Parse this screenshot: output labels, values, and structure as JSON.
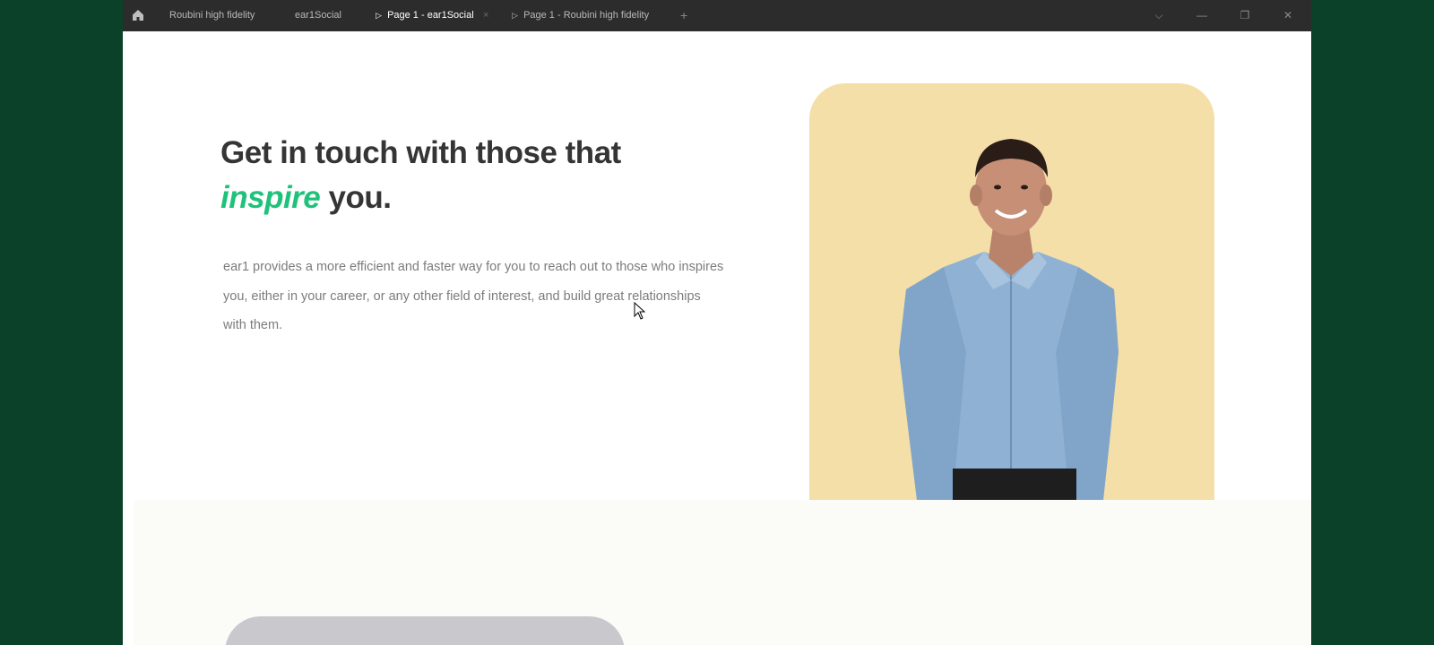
{
  "titlebar": {
    "tabs": [
      {
        "label": "Roubini high fidelity",
        "active": false,
        "has_play": false
      },
      {
        "label": "ear1Social",
        "active": false,
        "has_play": false
      },
      {
        "label": "Page 1 - ear1Social",
        "active": true,
        "has_play": true
      },
      {
        "label": "Page 1 - Roubini high fidelity",
        "active": false,
        "has_play": true
      }
    ],
    "close_glyph": "×",
    "add_glyph": "+",
    "controls": {
      "dropdown": "⌵",
      "minimize": "—",
      "restore": "❐",
      "close": "✕"
    }
  },
  "hero": {
    "title_line1": "Get in touch with those that",
    "title_accent": "inspire",
    "title_rest": " you.",
    "description": "ear1 provides a more efficient and faster way for you to reach out to those who inspires you, either in your career, or any other field of interest, and build great relationships with them."
  },
  "colors": {
    "accent": "#1fc27a",
    "image_background": "#f5dfa9",
    "titlebar": "#2c2c2c",
    "desktop": "#0b4129"
  },
  "icons": {
    "home": "home-icon",
    "cursor": "mouse-cursor-icon",
    "person": "person-photo"
  }
}
